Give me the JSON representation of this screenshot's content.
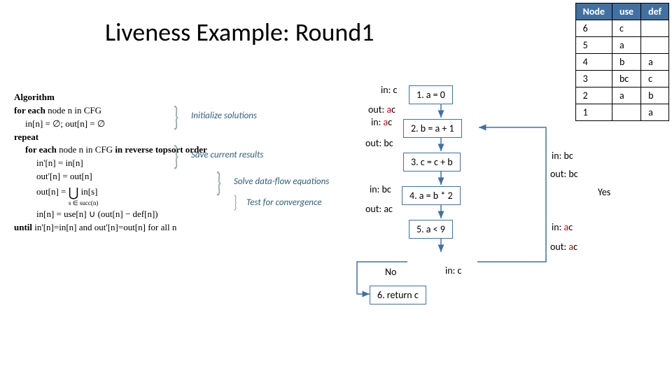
{
  "title": "Liveness Example: Round1",
  "algorithm": {
    "heading": "Algorithm",
    "lines": {
      "l1": "for each node n in CFG",
      "l2": "in[n] = ∅;  out[n] = ∅",
      "l3": "repeat",
      "l4": "for each node n in CFG in reverse topsort order",
      "l5": "in'[n] = in[n]",
      "l6": "out'[n] = out[n]",
      "l7a": "out[n] = ",
      "l7b": " in[s]",
      "l7sub": "s ∈ succ(n)",
      "l8": "in[n] = use[n] ∪ (out[n] − def[n])",
      "l9": "until in'[n]=in[n] and out'[n]=out[n] for all n"
    },
    "annotations": {
      "a1": "Initialize solutions",
      "a2": "Save current results",
      "a3": "Solve data-flow equations",
      "a4": "Test for convergence"
    }
  },
  "table": {
    "headers": [
      "Node",
      "use",
      "def"
    ],
    "rows": [
      {
        "node": "6",
        "use": "c",
        "def": ""
      },
      {
        "node": "5",
        "use": "a",
        "def": ""
      },
      {
        "node": "4",
        "use": "b",
        "def": "a"
      },
      {
        "node": "3",
        "use": "bc",
        "def": "c"
      },
      {
        "node": "2",
        "use": "a",
        "def": "b"
      },
      {
        "node": "1",
        "use": "",
        "def": "a"
      }
    ]
  },
  "flow": {
    "n1": "1.   a = 0",
    "n2": "2.   b = a + 1",
    "n3": "3.    c = c + b",
    "n4": "4.    a = b * 2",
    "n5": "5.    a < 9",
    "n6": "6. return c",
    "in1": "in: c",
    "out1": "out: ac",
    "in2": "in: ac",
    "out2": "out: bc",
    "in3": "in: bc",
    "out3": "out: bc",
    "in4": "in: bc",
    "out4": "out: ac",
    "in5": "in: ac",
    "out5": "out: ac",
    "in6": "in: c",
    "yes": "Yes",
    "no": "No"
  }
}
